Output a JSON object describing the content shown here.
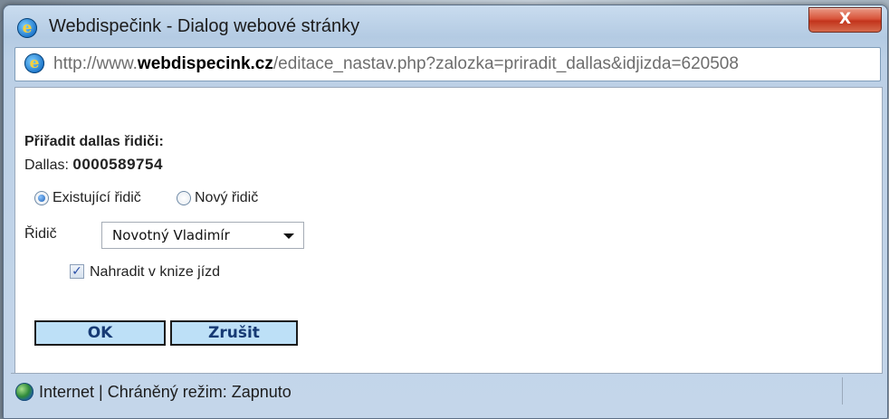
{
  "window": {
    "title": "Webdispečink - Dialog webové stránky",
    "close_label": "X"
  },
  "address": {
    "prefix": "http://www.",
    "domain": "webdispecink.cz",
    "path": "/editace_nastav.php?zalozka=priradit_dallas&idjizda=620508"
  },
  "form": {
    "heading": "Přiřadit dallas řidiči:",
    "dallas_label": "Dallas:",
    "dallas_value": "0000589754",
    "radio_existing": "Existující řidič",
    "radio_new": "Nový řidič",
    "radio_selected": "existing",
    "driver_label": "Řidič",
    "driver_value": "Novotný Vladimír",
    "replace_label": "Nahradit v knize jízd",
    "replace_checked": true
  },
  "buttons": {
    "ok": "OK",
    "cancel": "Zrušit"
  },
  "status": {
    "text": "Internet | Chráněný režim: Zapnuto"
  },
  "icons": {
    "title": "ie-icon",
    "address": "ie-icon",
    "status": "globe-icon",
    "check": "✓"
  }
}
